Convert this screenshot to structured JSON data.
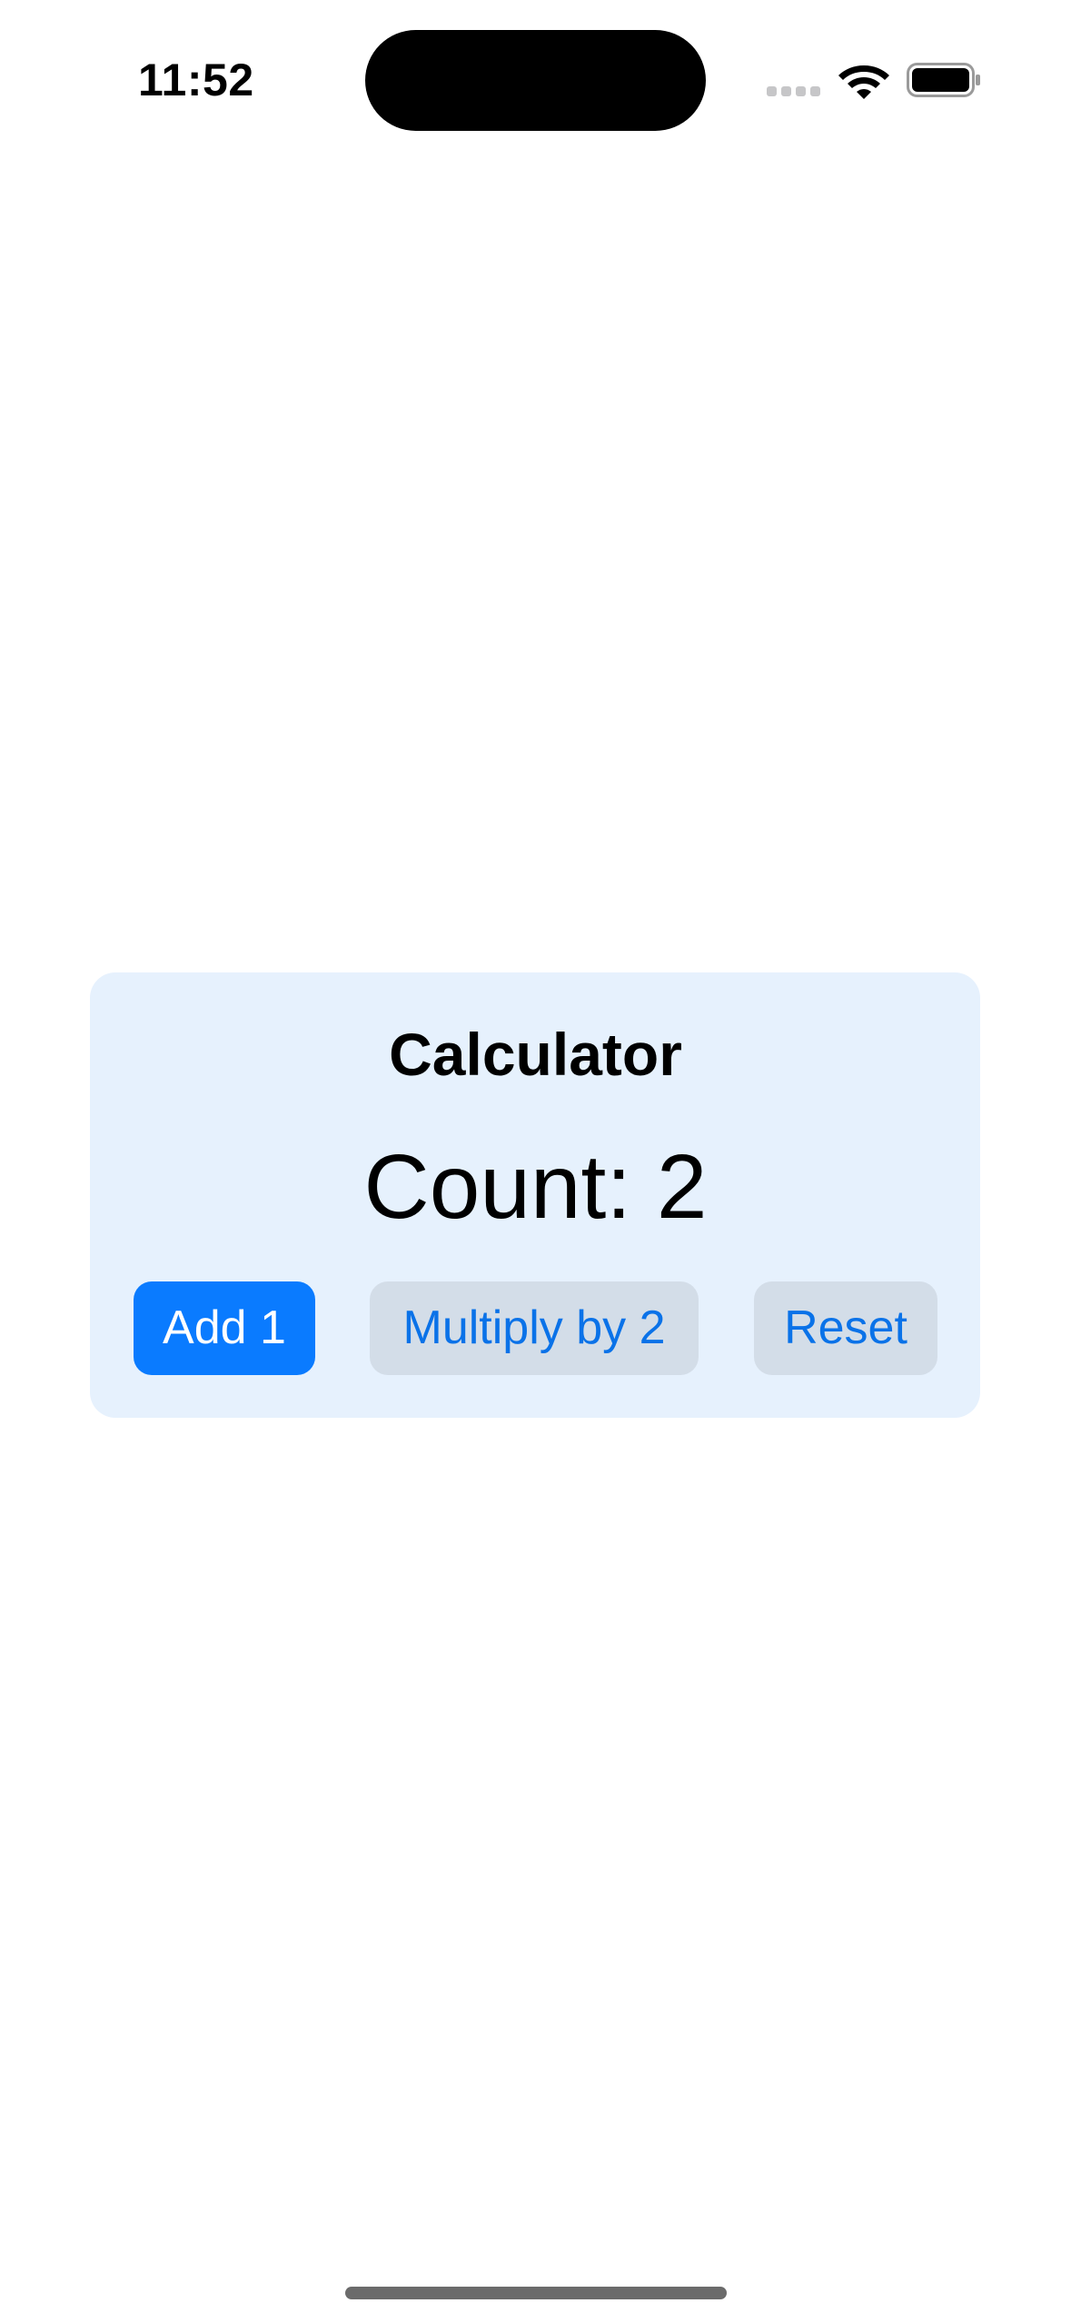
{
  "status_bar": {
    "time": "11:52",
    "icons": [
      "cellular-signal-icon",
      "wifi-icon",
      "battery-icon"
    ]
  },
  "card": {
    "title": "Calculator",
    "count_text": "Count: 2",
    "buttons": {
      "add": "Add 1",
      "multiply": "Multiply by 2",
      "reset": "Reset"
    }
  },
  "colors": {
    "accent": "#0a7bff",
    "card_background": "#e6f1fd",
    "secondary_button": "#d3dde8",
    "secondary_text": "#0a72e8"
  }
}
